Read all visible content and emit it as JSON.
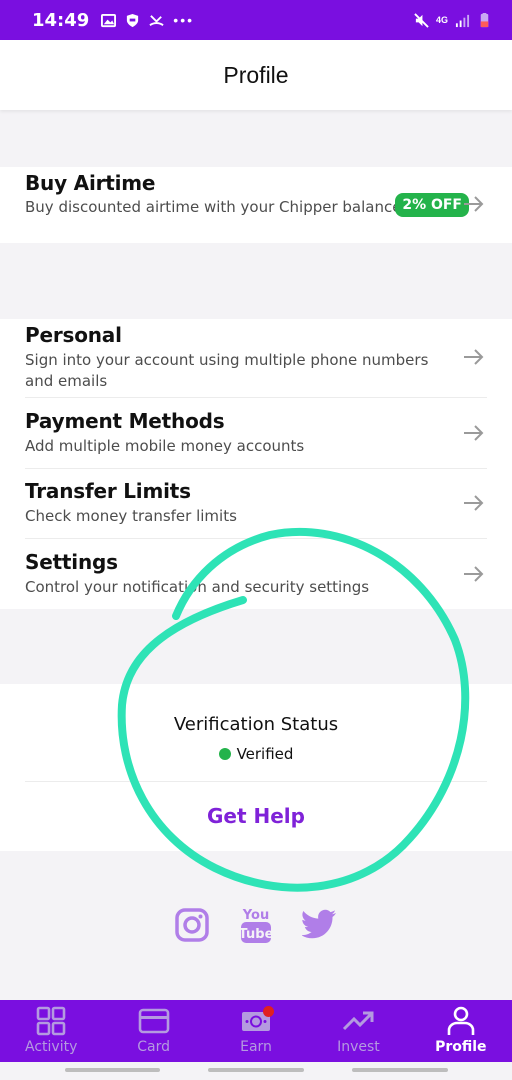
{
  "status_bar": {
    "time": "14:49",
    "network": "4G"
  },
  "header": {
    "title": "Profile"
  },
  "airtime": {
    "title": "Buy Airtime",
    "description": "Buy discounted airtime with your Chipper balance",
    "badge": "2% OFF"
  },
  "menu": [
    {
      "title": "Personal",
      "description": "Sign into your account using multiple phone numbers and emails"
    },
    {
      "title": "Payment Methods",
      "description": "Add multiple mobile money accounts"
    },
    {
      "title": "Transfer Limits",
      "description": "Check money transfer limits"
    },
    {
      "title": "Settings",
      "description": "Control your notification and security settings"
    }
  ],
  "verification": {
    "title": "Verification Status",
    "status": "Verified",
    "help": "Get Help"
  },
  "social": [
    "instagram-icon",
    "youtube-icon",
    "twitter-icon"
  ],
  "nav": [
    {
      "label": "Activity",
      "icon": "activity-icon"
    },
    {
      "label": "Card",
      "icon": "card-icon"
    },
    {
      "label": "Earn",
      "icon": "earn-icon"
    },
    {
      "label": "Invest",
      "icon": "invest-icon"
    },
    {
      "label": "Profile",
      "icon": "profile-icon"
    }
  ],
  "colors": {
    "brand": "#7a0fe0",
    "success": "#24b34b",
    "link": "#7f22d8",
    "annotation": "#2ee3b6"
  }
}
